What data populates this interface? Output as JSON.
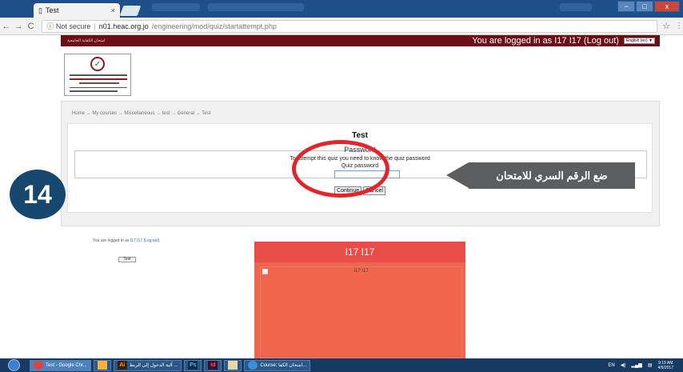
{
  "browser": {
    "tab_title": "Test",
    "tab_close": "×",
    "back": "←",
    "forward": "→",
    "reload": "C",
    "security_label": "ⓘ Not secure",
    "separator": "|",
    "url_host": "n01.heac.org.jo",
    "url_path": "/engineering/mod/quiz/startattempt.php",
    "bookmark": "☆",
    "menu": "⋮",
    "win_min": "−",
    "win_max": "□",
    "win_close": "x"
  },
  "site_header": {
    "rtl_label": "امتحان الكفاية الجامعية",
    "logged_in_text": "You are logged in as I17 I17 (Log out)",
    "language": "English (en) ▼"
  },
  "breadcrumb": "Home → My courses → Miscellaneous → test → General → Test",
  "quiz": {
    "title": "Test",
    "password_legend": "Password",
    "password_note": "To attempt this quiz you need to know the quiz password",
    "password_label": "Quiz password",
    "continue_label": "Continue",
    "cancel_label": "Cancel"
  },
  "annotation": {
    "callout_text": "ضع الرقم السري للامتحان",
    "step_number": "14",
    "highlight_color": "#e1262b",
    "callout_color": "#5c5d5f",
    "badge_color": "#16476f"
  },
  "footer": {
    "logged_prefix": "You are logged in as ",
    "logged_user": "I17 I17",
    "logged_suffix": " (Log out)",
    "button_label": "Test"
  },
  "user_block": {
    "name": "I17 I17",
    "image_alt": "I17 I17"
  },
  "taskbar": {
    "items": [
      {
        "icon": "chrome-icon",
        "label": "Test - Google Chr..."
      },
      {
        "icon": "folder-icon",
        "label": ""
      },
      {
        "icon": "illustrator-icon",
        "glyph": "Ai",
        "label": "آلية الدخول إلى الربط ..."
      },
      {
        "icon": "photoshop-icon",
        "glyph": "Ps",
        "label": ""
      },
      {
        "icon": "indesign-icon",
        "glyph": "Id",
        "label": ""
      },
      {
        "icon": "files-icon",
        "label": ""
      },
      {
        "icon": "ie-icon",
        "label": "Course: امتحان الكفا..."
      }
    ],
    "language": "EN",
    "time": "9:19 AM",
    "date": "4/6/2017"
  }
}
